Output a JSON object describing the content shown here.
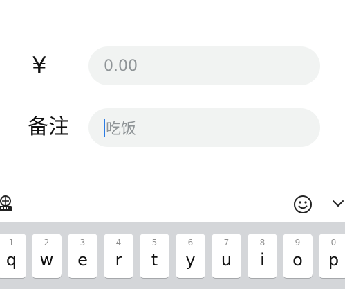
{
  "form": {
    "amount": {
      "label": "¥",
      "placeholder": "0.00"
    },
    "note": {
      "label": "备注",
      "placeholder": "吃饭"
    }
  },
  "keyboard": {
    "toolbar": {
      "left_icon": "keyboard-settings-icon",
      "emoji_icon": "emoji-icon",
      "collapse_icon": "chevron-down-icon"
    },
    "keys": [
      {
        "hint": "1",
        "letter": "q"
      },
      {
        "hint": "2",
        "letter": "w"
      },
      {
        "hint": "3",
        "letter": "e"
      },
      {
        "hint": "4",
        "letter": "r"
      },
      {
        "hint": "5",
        "letter": "t"
      },
      {
        "hint": "6",
        "letter": "y"
      },
      {
        "hint": "7",
        "letter": "u"
      },
      {
        "hint": "8",
        "letter": "i"
      },
      {
        "hint": "9",
        "letter": "o"
      },
      {
        "hint": "0",
        "letter": "p"
      }
    ]
  },
  "colors": {
    "caret": "#2a7be4",
    "field_bg": "#f1f3f2",
    "keyboard_bg": "#d4d6d9"
  }
}
